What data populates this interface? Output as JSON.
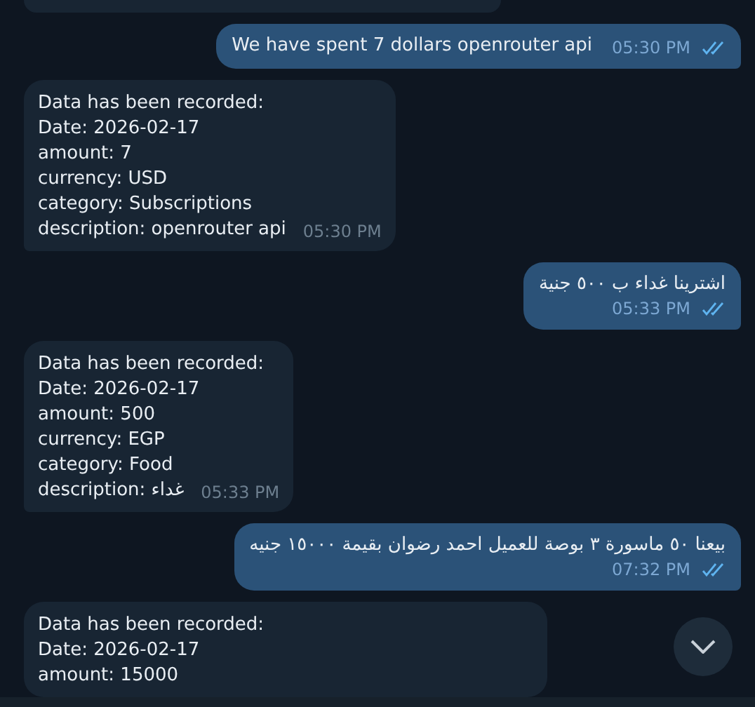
{
  "messages": [
    {
      "kind": "outgoing",
      "lines": [
        "We have spent 7 dollars openrouter api"
      ],
      "time": "05:30 PM",
      "read": true
    },
    {
      "kind": "incoming",
      "lines": [
        "Data has been recorded:",
        "Date: 2026-02-17",
        "amount: 7",
        "currency: USD",
        "category: Subscriptions",
        "description: openrouter api"
      ],
      "time": "05:30 PM"
    },
    {
      "kind": "outgoing",
      "lines": [
        "اشترينا غداء ب ٥٠٠ جنية"
      ],
      "time": "05:33 PM",
      "read": true
    },
    {
      "kind": "incoming",
      "lines": [
        "Data has been recorded:",
        "Date: 2026-02-17",
        "amount: 500",
        "currency: EGP",
        "category: Food",
        "description: غداء"
      ],
      "time": "05:33 PM"
    },
    {
      "kind": "outgoing",
      "lines": [
        "بيعنا ٥٠ ماسورة ٣ بوصة للعميل احمد رضوان بقيمة ١٥٠٠٠ جنيه"
      ],
      "time": "07:32 PM",
      "read": true
    },
    {
      "kind": "incoming",
      "lines": [
        "Data has been recorded:",
        "Date: 2026-02-17",
        "amount: 15000"
      ]
    }
  ]
}
